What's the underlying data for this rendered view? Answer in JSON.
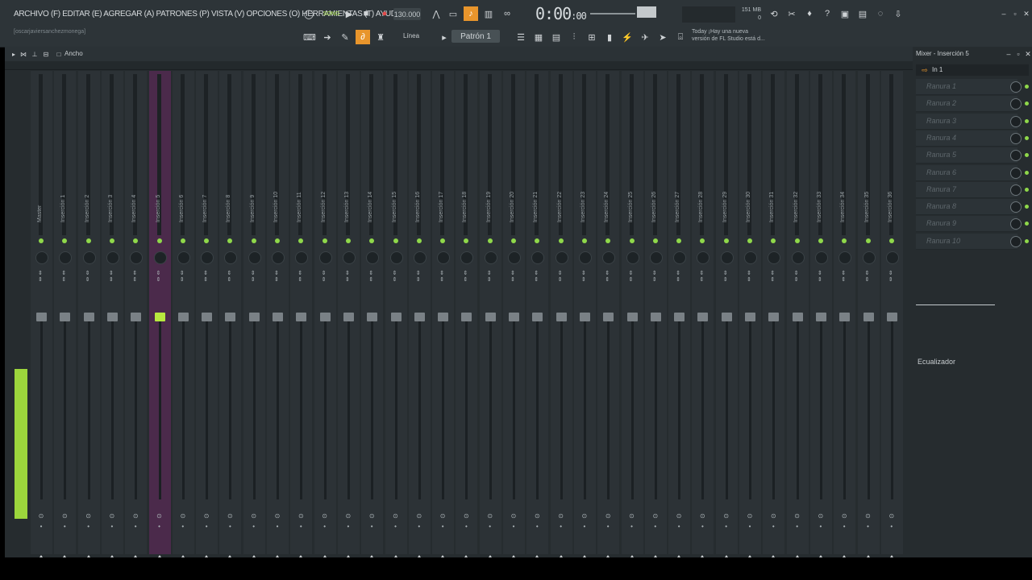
{
  "menu": "ARCHIVO (F) EDITAR (E) AGREGAR (A) PATRONES (P) VISTA (V) OPCIONES (O) HERRAMIENTAS (T) AYUDA",
  "hint": "[oscarjaviersanchezmonega]",
  "transport": {
    "tempo": "130.000",
    "time_main": "0:00",
    "time_sub": ":00",
    "song_label": "SONG"
  },
  "memory": {
    "mb": "151 MB",
    "num": "0"
  },
  "news": {
    "line1": "Today ¡Hay una nueva",
    "line2": "versión de FL Studio está d..."
  },
  "toolbar": {
    "linea": "Línea",
    "pattern": "Patrón 1"
  },
  "mixer": {
    "title": "Ancho",
    "master_label": "Master",
    "inserts": [
      "Inserción 1",
      "Inserción 2",
      "Inserción 3",
      "Inserción 4",
      "Inserción 5",
      "Inserción 6",
      "Inserción 7",
      "Inserción 8",
      "Inserción 9",
      "Inserción 10",
      "Inserción 11",
      "Inserción 12",
      "Inserción 13",
      "Inserción 14",
      "Inserción 15",
      "Inserción 16",
      "Inserción 17",
      "Inserción 18",
      "Inserción 19",
      "Inserción 20",
      "Inserción 21",
      "Inserción 22",
      "Inserción 23",
      "Inserción 24",
      "Inserción 25",
      "Inserción 26",
      "Inserción 27",
      "Inserción 28",
      "Inserción 29",
      "Inserción 30",
      "Inserción 31",
      "Inserción 32",
      "Inserción 33",
      "Inserción 34",
      "Inserción 35",
      "Inserción 36"
    ],
    "selected_index": 4
  },
  "panel": {
    "title": "Mixer - Inserción 5",
    "input": "In 1",
    "slots": [
      "Ranura 1",
      "Ranura 2",
      "Ranura 3",
      "Ranura 4",
      "Ranura 5",
      "Ranura 6",
      "Ranura 7",
      "Ranura 8",
      "Ranura 9",
      "Ranura 10"
    ],
    "eq_label": "Ecualizador"
  },
  "colors": {
    "accent": "#9cd63c",
    "selected": "#4b2a4b"
  }
}
